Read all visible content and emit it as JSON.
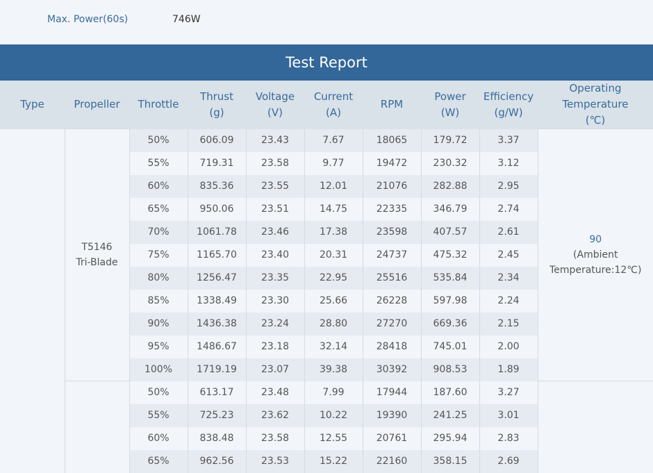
{
  "spec": {
    "max_power_label": "Max. Power(60s)",
    "max_power_value": "746W"
  },
  "report": {
    "title": "Test Report",
    "headers": {
      "type": "Type",
      "propeller": "Propeller",
      "throttle": "Throttle",
      "thrust": [
        "Thrust",
        "(g)"
      ],
      "voltage": [
        "Voltage",
        "(V)"
      ],
      "current": [
        "Current",
        "(A)"
      ],
      "rpm": "RPM",
      "power": [
        "Power",
        "(W)"
      ],
      "efficiency": [
        "Efficiency",
        "(g/W)"
      ],
      "temperature": [
        "Operating",
        "Temperature",
        "(℃)"
      ]
    },
    "groups": [
      {
        "propeller": [
          "T5146",
          "Tri-Blade"
        ],
        "temperature": "90",
        "temperature_note": [
          "(Ambient",
          "Temperature:12℃)"
        ],
        "rows": [
          {
            "throttle": "50%",
            "thrust": "606.09",
            "voltage": "23.43",
            "current": "7.67",
            "rpm": "18065",
            "power": "179.72",
            "efficiency": "3.37"
          },
          {
            "throttle": "55%",
            "thrust": "719.31",
            "voltage": "23.58",
            "current": "9.77",
            "rpm": "19472",
            "power": "230.32",
            "efficiency": "3.12"
          },
          {
            "throttle": "60%",
            "thrust": "835.36",
            "voltage": "23.55",
            "current": "12.01",
            "rpm": "21076",
            "power": "282.88",
            "efficiency": "2.95"
          },
          {
            "throttle": "65%",
            "thrust": "950.06",
            "voltage": "23.51",
            "current": "14.75",
            "rpm": "22335",
            "power": "346.79",
            "efficiency": "2.74"
          },
          {
            "throttle": "70%",
            "thrust": "1061.78",
            "voltage": "23.46",
            "current": "17.38",
            "rpm": "23598",
            "power": "407.57",
            "efficiency": "2.61"
          },
          {
            "throttle": "75%",
            "thrust": "1165.70",
            "voltage": "23.40",
            "current": "20.31",
            "rpm": "24737",
            "power": "475.32",
            "efficiency": "2.45"
          },
          {
            "throttle": "80%",
            "thrust": "1256.47",
            "voltage": "23.35",
            "current": "22.95",
            "rpm": "25516",
            "power": "535.84",
            "efficiency": "2.34"
          },
          {
            "throttle": "85%",
            "thrust": "1338.49",
            "voltage": "23.30",
            "current": "25.66",
            "rpm": "26228",
            "power": "597.98",
            "efficiency": "2.24"
          },
          {
            "throttle": "90%",
            "thrust": "1436.38",
            "voltage": "23.24",
            "current": "28.80",
            "rpm": "27270",
            "power": "669.36",
            "efficiency": "2.15"
          },
          {
            "throttle": "95%",
            "thrust": "1486.67",
            "voltage": "23.18",
            "current": "32.14",
            "rpm": "28418",
            "power": "745.01",
            "efficiency": "2.00"
          },
          {
            "throttle": "100%",
            "thrust": "1719.19",
            "voltage": "23.07",
            "current": "39.38",
            "rpm": "30392",
            "power": "908.53",
            "efficiency": "1.89"
          }
        ]
      },
      {
        "propeller": [
          "",
          ""
        ],
        "temperature": "",
        "temperature_note": [
          "",
          ""
        ],
        "rows": [
          {
            "throttle": "50%",
            "thrust": "613.17",
            "voltage": "23.48",
            "current": "7.99",
            "rpm": "17944",
            "power": "187.60",
            "efficiency": "3.27"
          },
          {
            "throttle": "55%",
            "thrust": "725.23",
            "voltage": "23.62",
            "current": "10.22",
            "rpm": "19390",
            "power": "241.25",
            "efficiency": "3.01"
          },
          {
            "throttle": "60%",
            "thrust": "838.48",
            "voltage": "23.58",
            "current": "12.55",
            "rpm": "20761",
            "power": "295.94",
            "efficiency": "2.83"
          },
          {
            "throttle": "65%",
            "thrust": "962.56",
            "voltage": "23.53",
            "current": "15.22",
            "rpm": "22160",
            "power": "358.15",
            "efficiency": "2.69"
          }
        ]
      }
    ]
  }
}
